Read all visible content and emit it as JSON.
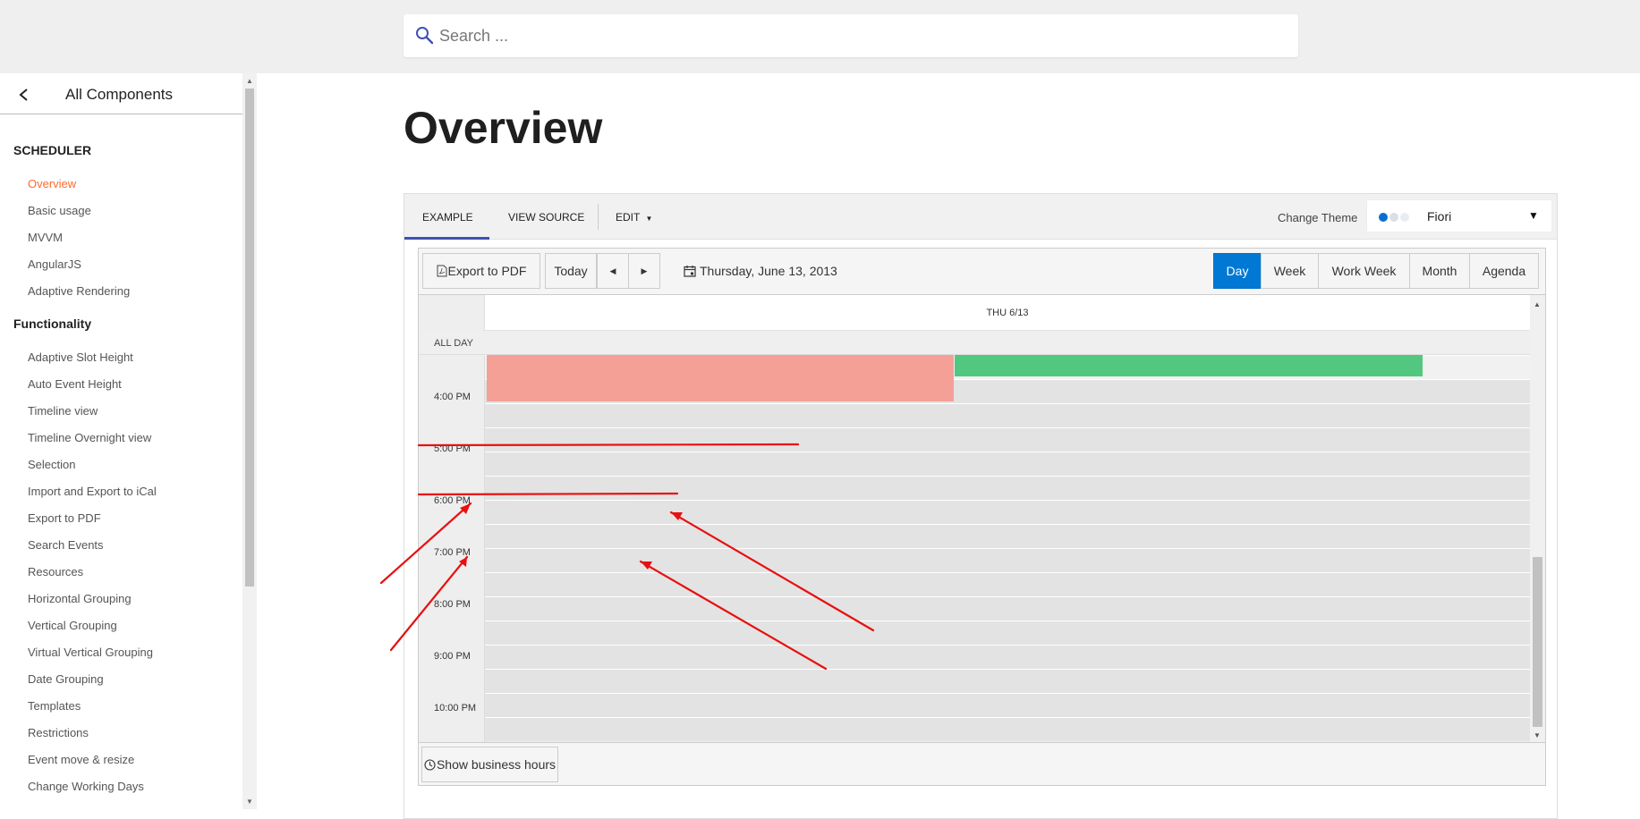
{
  "search": {
    "placeholder": "Search ..."
  },
  "sidebar": {
    "back_title": "All Components",
    "sections": [
      {
        "title": "SCHEDULER",
        "items": [
          {
            "label": "Overview",
            "active": true
          },
          {
            "label": "Basic usage"
          },
          {
            "label": "MVVM"
          },
          {
            "label": "AngularJS"
          },
          {
            "label": "Adaptive Rendering"
          }
        ]
      },
      {
        "title": "Functionality",
        "items": [
          {
            "label": "Adaptive Slot Height"
          },
          {
            "label": "Auto Event Height"
          },
          {
            "label": "Timeline view"
          },
          {
            "label": "Timeline Overnight view"
          },
          {
            "label": "Selection"
          },
          {
            "label": "Import and Export to iCal"
          },
          {
            "label": "Export to PDF"
          },
          {
            "label": "Search Events"
          },
          {
            "label": "Resources"
          },
          {
            "label": "Horizontal Grouping"
          },
          {
            "label": "Vertical Grouping"
          },
          {
            "label": "Virtual Vertical Grouping"
          },
          {
            "label": "Date Grouping"
          },
          {
            "label": "Templates"
          },
          {
            "label": "Restrictions"
          },
          {
            "label": "Event move & resize"
          },
          {
            "label": "Change Working Days"
          }
        ]
      }
    ]
  },
  "page": {
    "title": "Overview"
  },
  "demo": {
    "tabs": {
      "example": "EXAMPLE",
      "view_source": "VIEW SOURCE",
      "edit": "EDIT"
    },
    "theme": {
      "label": "Change Theme",
      "value": "Fiori",
      "dot_colors": [
        "#0a6ed1",
        "#d9dfe5",
        "#e9edf1"
      ]
    }
  },
  "scheduler": {
    "toolbar": {
      "export_pdf": "Export to PDF",
      "today": "Today",
      "date": "Thursday, June 13, 2013",
      "views": [
        "Day",
        "Week",
        "Work Week",
        "Month",
        "Agenda"
      ],
      "selected_view": "Day"
    },
    "day_header": "THU 6/13",
    "all_day": "ALL DAY",
    "times": [
      "4:00 PM",
      "5:00 PM",
      "6:00 PM",
      "7:00 PM",
      "8:00 PM",
      "9:00 PM",
      "10:00 PM"
    ],
    "events": [
      {
        "color": "#f4a097"
      },
      {
        "color": "#52c77f"
      }
    ],
    "footer": {
      "business_hours": "Show business hours"
    }
  },
  "colors": {
    "accent": "#ff6a2a",
    "selected_view": "#0078d4",
    "annotation": "#e81010"
  }
}
